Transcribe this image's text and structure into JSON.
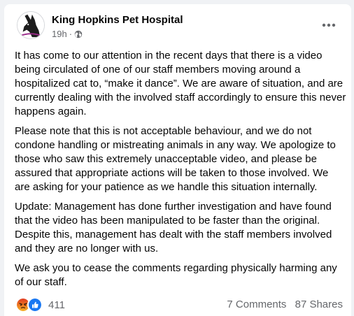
{
  "post": {
    "page_name": "King Hopkins Pet Hospital",
    "time": "19h",
    "separator": "·",
    "privacy_icon": "globe-icon",
    "avatar_icon": "dog-silhouette-icon",
    "more_icon": "more-options-icon",
    "paragraphs": [
      "It has come to our attention in the recent days that there is a video being circulated of one of our staff members moving around a hospitalized cat to, “make it dance”. We are aware of situation, and are currently dealing with the involved staff accordingly to ensure this never happens again.",
      "Please note that this is not acceptable behaviour, and we do not condone handling or mistreating animals in any way. We apologize to those who saw this extremely unacceptable video, and please be assured that appropriate actions will be taken to those involved. We are asking for your patience as we handle this situation internally.",
      "Update: Management has done further investigation and have found that the video has been manipulated to be faster than the original. Despite this, management has dealt with the staff members involved and they are no longer with us.",
      "We ask you to cease the comments regarding physically harming any of our staff."
    ]
  },
  "footer": {
    "reaction_icons": [
      "angry-reaction-icon",
      "like-reaction-icon"
    ],
    "reaction_count": "411",
    "comments": "7 Comments",
    "shares": "87 Shares"
  },
  "colors": {
    "background": "#f0f2f5",
    "card": "#ffffff",
    "text": "#050505",
    "secondary_text": "#65676b",
    "like_blue": "#1877f2",
    "angry_orange": "#e9710f"
  }
}
